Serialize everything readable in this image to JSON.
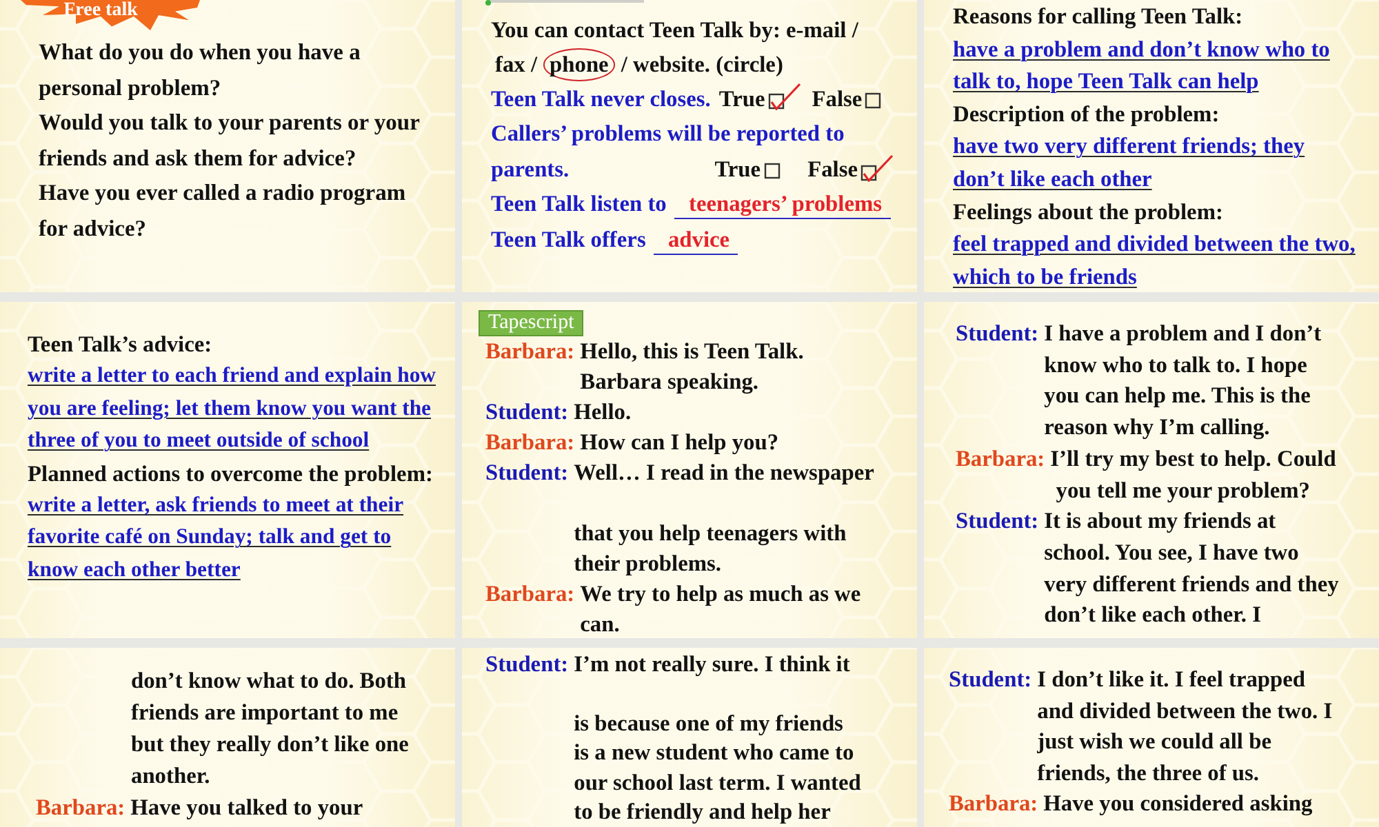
{
  "slides": [
    {
      "kind": "questions",
      "badge": {
        "kind": "starburst",
        "text": "Free talk"
      },
      "questions": [
        "What do you do when you have a personal problem?",
        "Would you talk to your parents or your friends and ask them for advice?",
        "Have you ever called a radio program for advice?"
      ]
    },
    {
      "kind": "exercise",
      "items": [
        {
          "kind": "circle",
          "prompt": "You can contact Teen Talk by: e-mail /",
          "options": [
            {
              "text": "fax /",
              "selected": false
            },
            {
              "text": "phone",
              "selected": true
            },
            {
              "text": "/ website. (circle)",
              "selected": false
            }
          ]
        },
        {
          "kind": "true_false",
          "statement_lines": [
            "Teen Talk never closes."
          ],
          "options": [
            {
              "label": "True",
              "checked": true
            },
            {
              "label": "False",
              "checked": false
            }
          ]
        },
        {
          "kind": "true_false",
          "statement_lines": [
            "Callers’ problems will be reported to",
            "parents."
          ],
          "options": [
            {
              "label": "True",
              "checked": false
            },
            {
              "label": "False",
              "checked": true
            }
          ]
        },
        {
          "kind": "fill_in",
          "prompt": "Teen Talk listen to",
          "answer": "teenagers’ problems"
        },
        {
          "kind": "fill_in",
          "prompt": "Teen Talk offers",
          "answer": "advice"
        }
      ]
    },
    {
      "kind": "notes",
      "sections": [
        {
          "heading": "Reasons for calling Teen Talk:",
          "answer": "have a problem and don’t know who to\ntalk to, hope Teen Talk can help"
        },
        {
          "heading": "Description of the problem:",
          "answer": "have two very different friends; they\ndon’t like each other"
        },
        {
          "heading": "Feelings about the problem:",
          "answer": "feel trapped and divided between the two,\nwhich to be friends"
        }
      ]
    },
    {
      "kind": "notes",
      "sections": [
        {
          "heading": "Teen Talk’s advice:",
          "answer": "write a letter to each friend and explain how\nyou are feeling; let them know you want the\nthree of you to meet outside of school"
        },
        {
          "heading": "Planned actions to overcome the problem:",
          "answer": "write a letter, ask friends to meet at their\nfavorite café on Sunday; talk and get to\nknow each other better"
        }
      ]
    },
    {
      "kind": "dialogue",
      "badge": {
        "kind": "tab",
        "text": "Tapescript"
      },
      "turns": [
        {
          "kind": "turn",
          "speaker": "Barbara:",
          "color": "#e0481e",
          "text": "Hello, this is Teen Talk.\nBarbara speaking."
        },
        {
          "kind": "turn",
          "speaker": "Student:",
          "color": "#1a1ab4",
          "text": "Hello."
        },
        {
          "kind": "turn",
          "speaker": "Barbara:",
          "color": "#e0481e",
          "text": "How can I help you?"
        },
        {
          "kind": "turn",
          "speaker": "Student:",
          "color": "#1a1ab4",
          "text": "Well… I read in the newspaper\n\nthat you help teenagers with\ntheir problems."
        },
        {
          "kind": "turn",
          "speaker": "Barbara:",
          "color": "#e0481e",
          "text": "We try to help as much as we\ncan."
        }
      ]
    },
    {
      "kind": "dialogue",
      "turns": [
        {
          "kind": "turn",
          "speaker": "Student:",
          "color": "#1a1ab4",
          "text": "I have a problem and I don’t\nknow who to talk to. I hope\nyou can help me. This is the\nreason why I’m calling."
        },
        {
          "kind": "turn",
          "speaker": "Barbara:",
          "color": "#e0481e",
          "text": "I’ll try my best to help. Could\n you tell me your problem?"
        },
        {
          "kind": "turn",
          "speaker": "Student:",
          "color": "#1a1ab4",
          "text": "It is about my friends at\nschool. You see, I have two\nvery different friends and they\ndon’t like each other. I"
        }
      ]
    },
    {
      "kind": "dialogue",
      "turns": [
        {
          "kind": "continued",
          "text": "don’t know what to do. Both\nfriends are important to me\nbut they really don’t like one\nanother."
        },
        {
          "kind": "turn",
          "speaker": "Barbara:",
          "color": "#e0481e",
          "text": "Have you talked to your"
        }
      ]
    },
    {
      "kind": "dialogue",
      "turns": [
        {
          "kind": "turn",
          "speaker": "Student:",
          "color": "#1a1ab4",
          "text": "I’m not really sure. I think it\n\nis because one of my friends\nis a new student who came to\nour school last term. I wanted\nto be friendly and help her"
        }
      ]
    },
    {
      "kind": "dialogue",
      "turns": [
        {
          "kind": "turn",
          "speaker": "Student:",
          "color": "#1a1ab4",
          "text": "I don’t like it. I feel trapped\nand divided between the two. I\njust wish we could all be\nfriends, the three of us."
        },
        {
          "kind": "turn",
          "speaker": "Barbara:",
          "color": "#e0481e",
          "text": "Have you considered asking"
        }
      ]
    }
  ]
}
